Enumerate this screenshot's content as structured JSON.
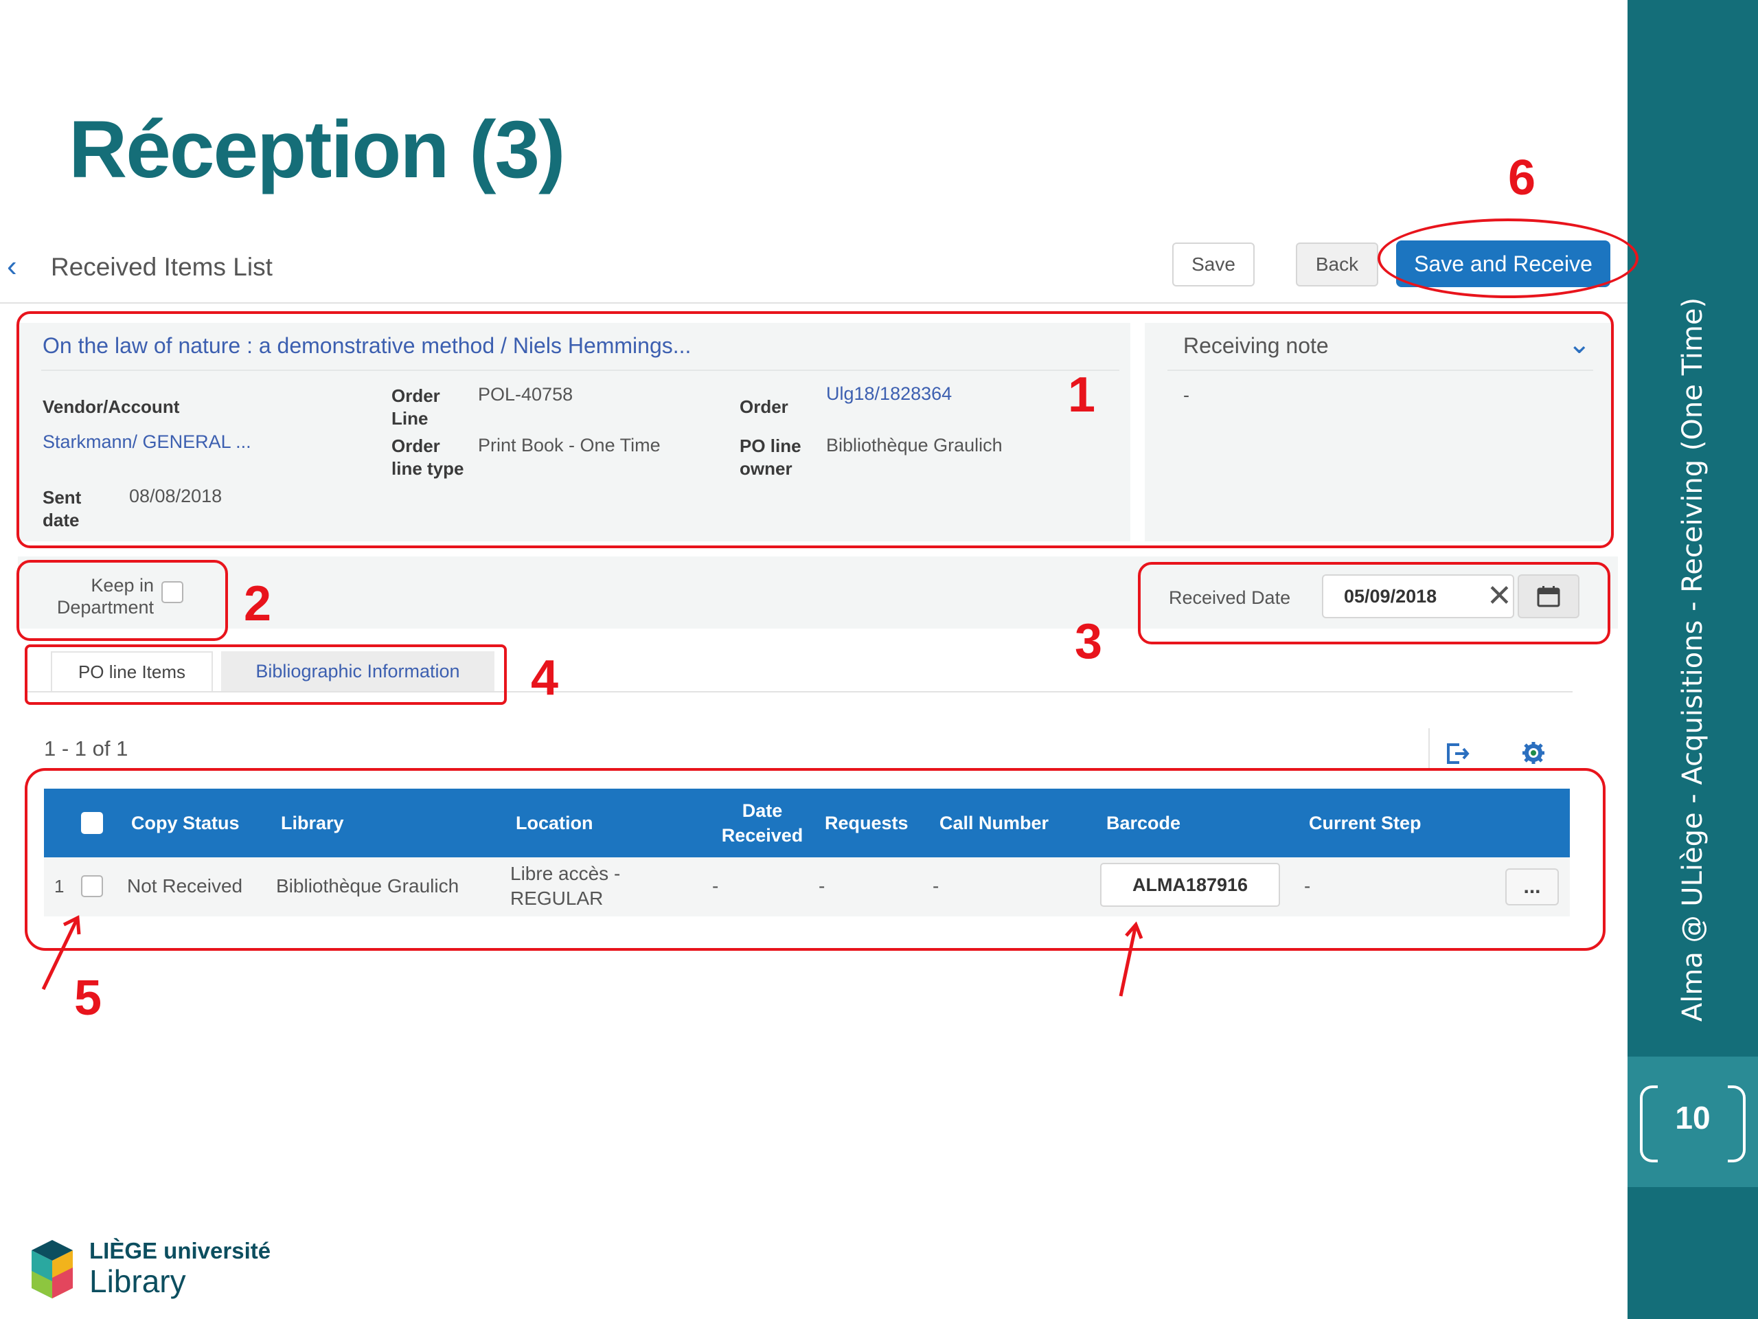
{
  "slide": {
    "title": "Réception (3)",
    "sidebar_text": "Alma @ ULiège - Acquisitions - Receiving (One Time)",
    "page_number": "10",
    "logo_line1": "LIÈGE université",
    "logo_line2": "Library"
  },
  "header": {
    "back_label": "Received Items List",
    "save_label": "Save",
    "back_button_label": "Back",
    "save_receive_label": "Save and Receive"
  },
  "po": {
    "title": "On the law of nature : a demonstrative method / Niels Hemmings...",
    "vendor_label": "Vendor/Account",
    "vendor_value": "Starkmann/ GENERAL ...",
    "sent_date_label": "Sent date",
    "sent_date_value": "08/08/2018",
    "order_line_label": "Order Line",
    "order_line_value": "POL-40758",
    "order_line_type_label": "Order line type",
    "order_line_type_value": "Print Book - One Time",
    "order_label": "Order",
    "order_value": "Ulg18/1828364",
    "po_line_owner_label": "PO line owner",
    "po_line_owner_value": "Bibliothèque Graulich"
  },
  "receiving_note": {
    "title": "Receiving note",
    "value": "-"
  },
  "options": {
    "keep_in_department_label": "Keep in Department",
    "received_date_label": "Received Date",
    "received_date_value": "05/09/2018"
  },
  "tabs": [
    {
      "label": "PO line Items"
    },
    {
      "label": "Bibliographic Information"
    }
  ],
  "table": {
    "pager": "1 - 1 of 1",
    "headers": [
      "Copy Status",
      "Library",
      "Location",
      "Date Received",
      "Requests",
      "Call Number",
      "Barcode",
      "Current Step"
    ],
    "rows": [
      {
        "index": "1",
        "copy_status": "Not Received",
        "library": "Bibliothèque Graulich",
        "location": "Libre accès - REGULAR",
        "date_received": "-",
        "requests": "-",
        "call_number": "-",
        "barcode": "ALMA187916",
        "current_step": "-",
        "more": "..."
      }
    ]
  },
  "annotations": [
    "1",
    "2",
    "3",
    "4",
    "5",
    "6"
  ],
  "colors": {
    "teal": "#146e79",
    "primary_blue": "#1c75c0",
    "annotation_red": "#e8141c"
  }
}
